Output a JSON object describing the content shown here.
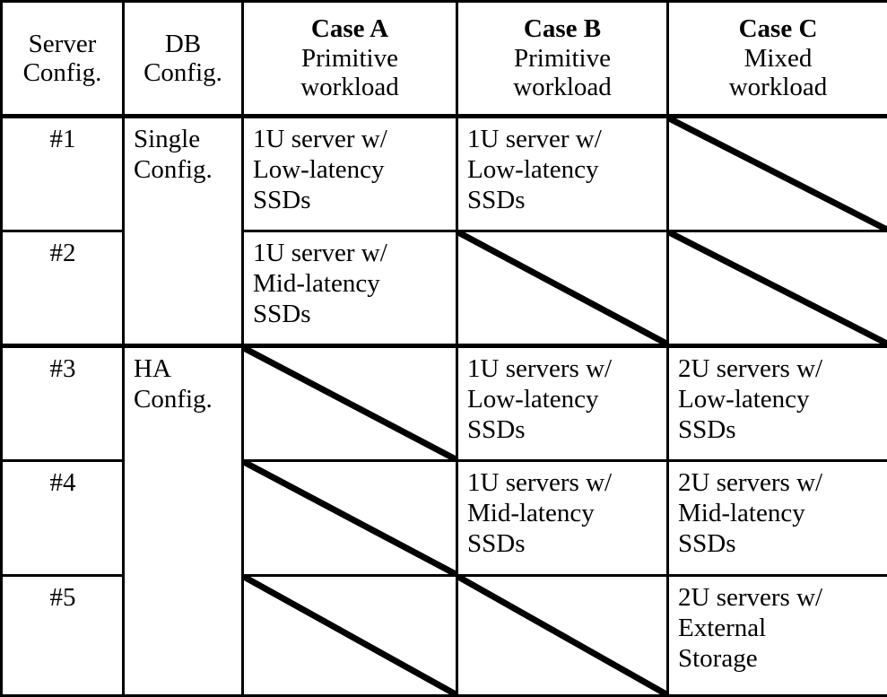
{
  "table": {
    "columns": [
      {
        "id": "server",
        "label": "Server\nConfig.",
        "bold_title": null
      },
      {
        "id": "db",
        "label": "DB\nConfig.",
        "bold_title": null
      },
      {
        "id": "case_a",
        "bold_title": "Case A",
        "sub": "Primitive\nworkload"
      },
      {
        "id": "case_b",
        "bold_title": "Case B",
        "sub": "Primitive\nworkload"
      },
      {
        "id": "case_c",
        "bold_title": "Case C",
        "sub": "Mixed\nworkload"
      }
    ],
    "header": {
      "col1_line1": "Server",
      "col1_line2": "Config.",
      "col2_line1": "DB",
      "col2_line2": "Config.",
      "col3_title": "Case A",
      "col3_sub1": "Primitive",
      "col3_sub2": "workload",
      "col4_title": "Case B",
      "col4_sub1": "Primitive",
      "col4_sub2": "workload",
      "col5_title": "Case C",
      "col5_sub1": "Mixed",
      "col5_sub2": "workload"
    },
    "groups": [
      {
        "id": "single",
        "label": "Single\nConfig.",
        "rows": 2
      },
      {
        "id": "ha",
        "label": "HA\nConfig.",
        "rows": 3
      }
    ],
    "rows": [
      {
        "server": "#1",
        "db_group": "Single\nConfig.",
        "case_a": "1U server w/\nLow-latency\nSSDs",
        "case_b": "1U server w/\nLow-latency\nSSDs",
        "case_c": null
      },
      {
        "server": "#2",
        "db_group": null,
        "case_a": "1U server w/\nMid-latency\nSSDs",
        "case_b": null,
        "case_c": null
      },
      {
        "server": "#3",
        "db_group": "HA\nConfig.",
        "case_a": null,
        "case_b": "1U servers w/\nLow-latency\nSSDs",
        "case_c": "2U servers w/\nLow-latency\nSSDs"
      },
      {
        "server": "#4",
        "db_group": null,
        "case_a": null,
        "case_b": "1U servers w/\nMid-latency\nSSDs",
        "case_c": "2U servers w/\nMid-latency\nSSDs"
      },
      {
        "server": "#5",
        "db_group": null,
        "case_a": null,
        "case_b": null,
        "case_c": "2U servers w/\nExternal\nStorage"
      }
    ],
    "style": {
      "border_color": "#000000",
      "background": "#ffffff",
      "text_color": "#000000"
    }
  }
}
